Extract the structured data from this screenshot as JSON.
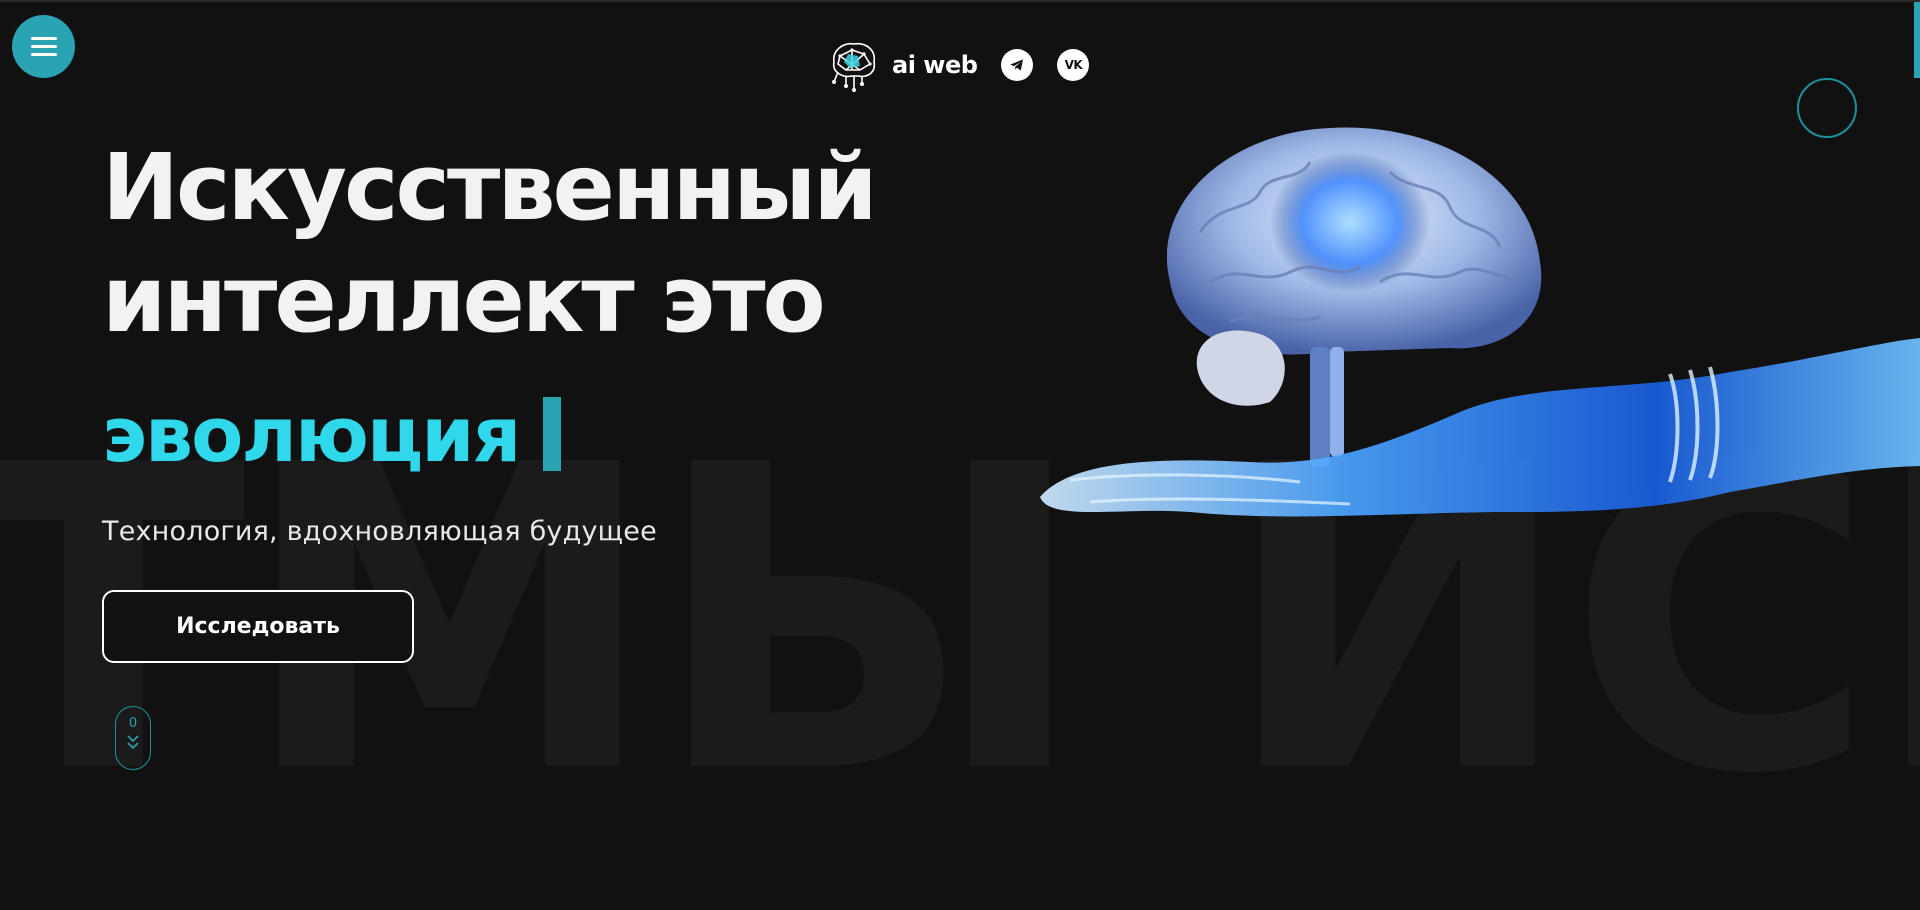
{
  "header": {
    "menu_icon": "hamburger-icon",
    "brand_name": "ai web",
    "logo_icon": "brain-network-logo",
    "social": [
      {
        "name": "telegram",
        "icon": "telegram-icon"
      },
      {
        "name": "vk",
        "icon": "vk-icon",
        "glyph": "VK"
      }
    ]
  },
  "hero": {
    "title_line1": "Искусственный",
    "title_line2": "интеллект это",
    "accent_word": "эволюция",
    "subtitle": "Технология, вдохновляющая будущее",
    "cta_label": "Исследовать",
    "scroll_counter": "0"
  },
  "background": {
    "watermark_text": "ТМЫ  ИСКУ"
  },
  "colors": {
    "background": "#111111",
    "accent": "#2aa3b3",
    "accent_text": "#2fd8ea",
    "text": "#f2f2f2"
  }
}
